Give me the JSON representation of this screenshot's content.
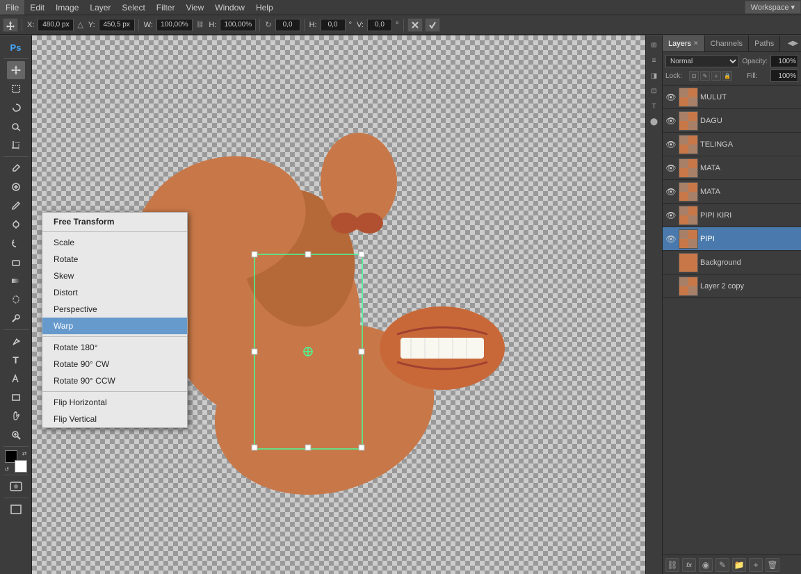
{
  "menubar": {
    "items": [
      "File",
      "Edit",
      "Image",
      "Layer",
      "Select",
      "Filter",
      "View",
      "Window",
      "Help"
    ]
  },
  "toolbar": {
    "move_label": "▸",
    "x_label": "X:",
    "x_value": "480,0 px",
    "y_label": "Y:",
    "y_value": "450,5 px",
    "w_label": "W:",
    "w_value": "100,00%",
    "h_label": "H:",
    "h_value": "100,00%",
    "rotate_label": "↻",
    "rot_value": "0,0",
    "h2_label": "H:",
    "h2_value": "0,0",
    "v_label": "V:",
    "v_value": "0,0",
    "deg_label": "°",
    "workspace_label": "Workspace",
    "workspace_arrow": "▾"
  },
  "context_menu": {
    "items": [
      {
        "label": "Free Transform",
        "type": "item"
      },
      {
        "label": "",
        "type": "separator"
      },
      {
        "label": "Scale",
        "type": "item"
      },
      {
        "label": "Rotate",
        "type": "item"
      },
      {
        "label": "Skew",
        "type": "item"
      },
      {
        "label": "Distort",
        "type": "item"
      },
      {
        "label": "Perspective",
        "type": "item"
      },
      {
        "label": "Warp",
        "type": "item",
        "highlighted": true
      },
      {
        "label": "",
        "type": "separator"
      },
      {
        "label": "Rotate 180°",
        "type": "item"
      },
      {
        "label": "Rotate 90° CW",
        "type": "item"
      },
      {
        "label": "Rotate 90° CCW",
        "type": "item"
      },
      {
        "label": "",
        "type": "separator"
      },
      {
        "label": "Flip Horizontal",
        "type": "item"
      },
      {
        "label": "Flip Vertical",
        "type": "item"
      }
    ]
  },
  "layers_panel": {
    "tabs": [
      {
        "label": "Layers",
        "active": true
      },
      {
        "label": "Channels",
        "active": false
      },
      {
        "label": "Paths",
        "active": false
      }
    ],
    "blend_mode": "Normal",
    "opacity_label": "Opacity:",
    "opacity_value": "100%",
    "lock_label": "Lock:",
    "fill_label": "Fill:",
    "fill_value": "100%",
    "layers": [
      {
        "name": "MULUT",
        "visible": true,
        "active": false,
        "thumb": "mulut"
      },
      {
        "name": "DAGU",
        "visible": true,
        "active": false,
        "thumb": "dagu"
      },
      {
        "name": "TELINGA",
        "visible": true,
        "active": false,
        "thumb": "telinga"
      },
      {
        "name": "MATA",
        "visible": true,
        "active": false,
        "thumb": "mata"
      },
      {
        "name": "MATA",
        "visible": true,
        "active": false,
        "thumb": "mata"
      },
      {
        "name": "PIPI KIRI",
        "visible": true,
        "active": false,
        "thumb": "pipi-kiri"
      },
      {
        "name": "PIPI",
        "visible": true,
        "active": true,
        "thumb": "pipi"
      },
      {
        "name": "Background",
        "visible": false,
        "active": false,
        "thumb": "bg"
      },
      {
        "name": "Layer 2 copy",
        "visible": false,
        "active": false,
        "thumb": "l2copy"
      }
    ],
    "bottom_icons": [
      "⛓",
      "fx",
      "◉",
      "✎",
      "🗁",
      "🗑"
    ]
  }
}
